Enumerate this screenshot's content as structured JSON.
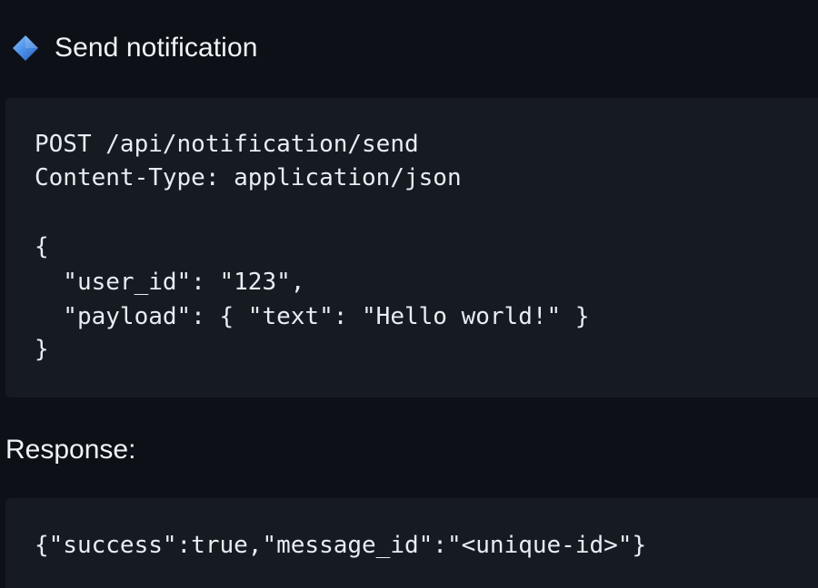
{
  "section": {
    "icon": "blue-diamond-icon",
    "title": "Send notification"
  },
  "request": {
    "lines": [
      "POST /api/notification/send",
      "Content-Type: application/json",
      "",
      "{",
      "  \"user_id\": \"123\",",
      "  \"payload\": { \"text\": \"Hello world!\" }",
      "}"
    ]
  },
  "response": {
    "label": "Response:",
    "lines": [
      "{\"success\":true,\"message_id\":\"<unique-id>\"}"
    ]
  },
  "colors": {
    "background": "#0d1117",
    "code_background": "#161b22",
    "text": "#e6edf3",
    "diamond": "#4a8fe7"
  }
}
